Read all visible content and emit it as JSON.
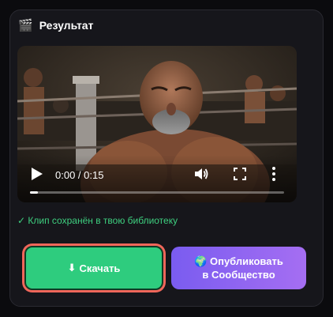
{
  "header": {
    "icon": "clapper-board-icon",
    "icon_glyph": "🎬",
    "title": "Результат"
  },
  "video": {
    "time_display": "0:00 / 0:15",
    "progress_fraction": 0.03
  },
  "status": {
    "saved_text": "✓ Клип сохранён в твою библиотеку"
  },
  "actions": {
    "download_icon": "⬇",
    "download_label": "Скачать",
    "publish_icon": "🌍",
    "publish_line1": "Опубликовать",
    "publish_line2": "в Сообщество"
  },
  "colors": {
    "accent_green": "#2ecc7e",
    "accent_purple": "#8b63f0",
    "highlight_ring": "#f0665a",
    "saved_text": "#3ecf7f"
  }
}
